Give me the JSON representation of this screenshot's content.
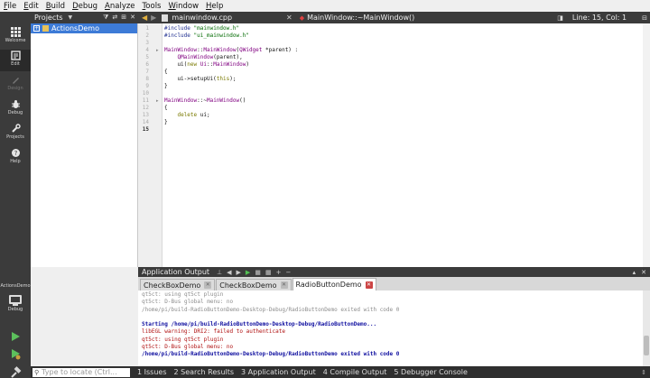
{
  "menu": [
    "File",
    "Edit",
    "Build",
    "Debug",
    "Analyze",
    "Tools",
    "Window",
    "Help"
  ],
  "modes": [
    {
      "label": "Welcome",
      "icon": "grid-icon"
    },
    {
      "label": "Edit",
      "icon": "edit-icon"
    },
    {
      "label": "Design",
      "icon": "design-icon"
    },
    {
      "label": "Debug",
      "icon": "bug-icon"
    },
    {
      "label": "Projects",
      "icon": "wrench-icon"
    },
    {
      "label": "Help",
      "icon": "help-icon"
    }
  ],
  "kit": {
    "name": "ActionsDemo",
    "mode": "Debug"
  },
  "projects": {
    "title": "Projects",
    "root": "ActionsDemo"
  },
  "editor_toolbar": {
    "file": "mainwindow.cpp",
    "symbol": "MainWindow::~MainWindow()",
    "position": "Line: 15, Col: 1"
  },
  "editor": {
    "current_line": 15,
    "lines": [
      [
        {
          "t": "#include ",
          "c": "pp"
        },
        {
          "t": "\"mainwindow.h\"",
          "c": "str"
        }
      ],
      [
        {
          "t": "#include ",
          "c": "pp"
        },
        {
          "t": "\"ui_mainwindow.h\"",
          "c": "str"
        }
      ],
      [],
      [
        {
          "t": "MainWindow",
          "c": "cls"
        },
        {
          "t": "::",
          "c": "plain"
        },
        {
          "t": "MainWindow",
          "c": "cls"
        },
        {
          "t": "(",
          "c": "plain"
        },
        {
          "t": "QWidget",
          "c": "cls"
        },
        {
          "t": " *parent) :",
          "c": "plain"
        }
      ],
      [
        {
          "t": "    ",
          "c": "plain"
        },
        {
          "t": "QMainWindow",
          "c": "cls"
        },
        {
          "t": "(parent),",
          "c": "plain"
        }
      ],
      [
        {
          "t": "    ui(",
          "c": "plain"
        },
        {
          "t": "new",
          "c": "kw"
        },
        {
          "t": " ",
          "c": "plain"
        },
        {
          "t": "Ui",
          "c": "cls"
        },
        {
          "t": "::",
          "c": "plain"
        },
        {
          "t": "MainWindow",
          "c": "cls"
        },
        {
          "t": ")",
          "c": "plain"
        }
      ],
      [
        {
          "t": "{",
          "c": "plain"
        }
      ],
      [
        {
          "t": "    ui->setupUi(",
          "c": "plain"
        },
        {
          "t": "this",
          "c": "kw"
        },
        {
          "t": ");",
          "c": "plain"
        }
      ],
      [
        {
          "t": "}",
          "c": "plain"
        }
      ],
      [],
      [
        {
          "t": "MainWindow",
          "c": "cls"
        },
        {
          "t": "::~",
          "c": "plain"
        },
        {
          "t": "MainWindow",
          "c": "cls"
        },
        {
          "t": "()",
          "c": "plain"
        }
      ],
      [
        {
          "t": "{",
          "c": "plain"
        }
      ],
      [
        {
          "t": "    ",
          "c": "plain"
        },
        {
          "t": "delete",
          "c": "kw"
        },
        {
          "t": " ui;",
          "c": "plain"
        }
      ],
      [
        {
          "t": "}",
          "c": "plain"
        }
      ],
      []
    ]
  },
  "output": {
    "title": "Application Output",
    "tabs": [
      "CheckBoxDemo",
      "CheckBoxDemo",
      "RadioButtonDemo"
    ],
    "lines": [
      {
        "t": "qt5ct: using qt5ct plugin",
        "c": "o-gray"
      },
      {
        "t": "qt5ct: D-Bus global menu: no",
        "c": "o-gray"
      },
      {
        "t": "/home/pi/build-RadioButtonDemo-Desktop-Debug/RadioButtonDemo exited with code 0",
        "c": "o-gray"
      },
      {
        "t": "",
        "c": "o-gray"
      },
      {
        "t": "Starting /home/pi/build-RadioButtonDemo-Desktop-Debug/RadioButtonDemo...",
        "c": "o-blue"
      },
      {
        "t": "libEGL warning: DRI2: failed to authenticate",
        "c": "o-red"
      },
      {
        "t": "qt5ct: using qt5ct plugin",
        "c": "o-red"
      },
      {
        "t": "qt5ct: D-Bus global menu: no",
        "c": "o-red"
      },
      {
        "t": "/home/pi/build-RadioButtonDemo-Desktop-Debug/RadioButtonDemo exited with code 0",
        "c": "o-blue"
      }
    ]
  },
  "status": {
    "locate_placeholder": "Type to locate (Ctrl...",
    "items": [
      "1 Issues",
      "2 Search Results",
      "3 Application Output",
      "4 Compile Output",
      "5 Debugger Console"
    ]
  }
}
